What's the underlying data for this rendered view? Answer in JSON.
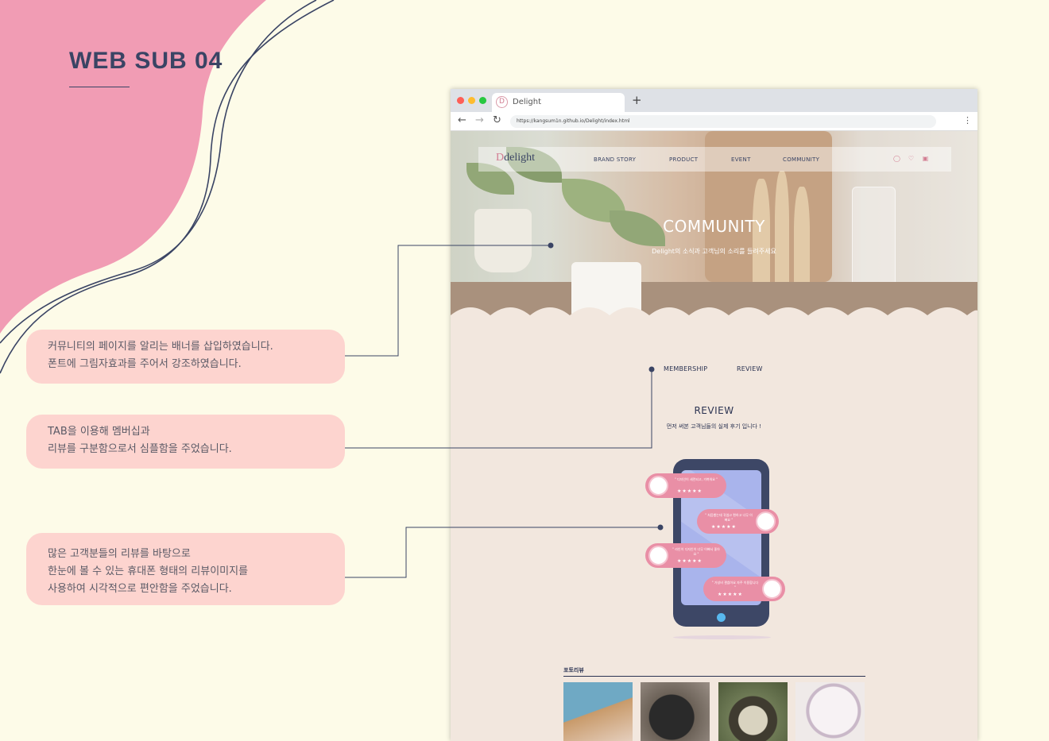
{
  "page": {
    "title": "WEB SUB 04"
  },
  "annotations": [
    {
      "lines": [
        "커뮤니티의 페이지를 알리는 배너를 삽입하였습니다.",
        "폰트에 그림자효과를 주어서 강조하였습니다."
      ]
    },
    {
      "lines": [
        "TAB을 이용해 멤버십과",
        "리뷰를 구분함으로서 심플함을 주었습니다."
      ]
    },
    {
      "lines": [
        "많은 고객분들의 리뷰를 바탕으로",
        "한눈에 볼 수 있는 휴대폰 형태의 리뷰이미지를",
        "사용하여 시각적으로 편안함을 주었습니다."
      ]
    }
  ],
  "browser": {
    "tab_title": "Delight",
    "new_tab_symbol": "+",
    "url": "https://kangsum1n.github.io/Delight/index.html"
  },
  "site": {
    "logo": "delight",
    "logo_mark": "D",
    "nav": [
      "BRAND STORY",
      "PRODUCT",
      "EVENT",
      "COMMUNITY"
    ],
    "hero_title": "COMMUNITY",
    "hero_subtitle": "Delight의 소식과 고객님의 소리를 들려주세요",
    "tabs": [
      "MEMBERSHIP",
      "REVIEW"
    ],
    "section_title": "REVIEW",
    "section_subtitle": "먼저 써본 고객님들의 실제 후기 입니다 !",
    "reviews": [
      {
        "text": "\" 디자인이 세련되고, 가벼워요 \"",
        "stars": "★★★★★"
      },
      {
        "text": "\" 처음봤는데 귀엽고 편하고 너무 이뻐요 \"",
        "stars": "★★★★★"
      },
      {
        "text": "\" 라인이 디자인이 너무 이뻐서 좋아요 \"",
        "stars": "★★★★★"
      },
      {
        "text": "\" 가성비 괜찮아요 자주 이용합니다 \"",
        "stars": "★★★★★"
      }
    ],
    "photo_review_heading": "포토리뷰"
  },
  "colors": {
    "background": "#fdfbe8",
    "blob_pink": "#f19cb4",
    "note_bg": "#fdd4cf",
    "navy": "#3a4464",
    "page_bg": "#f2e7de",
    "accent_pink": "#e98fa6"
  }
}
